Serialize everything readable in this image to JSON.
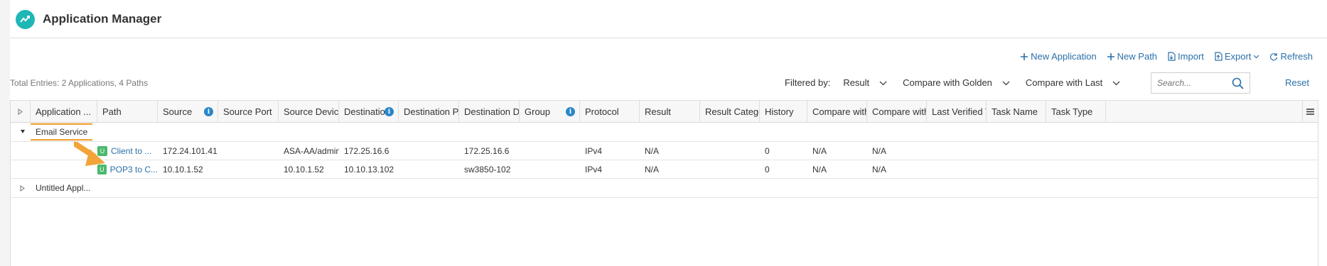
{
  "app": {
    "title": "Application Manager"
  },
  "toolbar": {
    "new_application": "New Application",
    "new_path": "New Path",
    "import": "Import",
    "export": "Export",
    "refresh": "Refresh"
  },
  "summary": {
    "total_entries": "Total Entries: 2 Applications, 4 Paths"
  },
  "filters": {
    "label": "Filtered by:",
    "result": "Result",
    "compare_golden": "Compare with Golden",
    "compare_last": "Compare with Last",
    "search_placeholder": "Search...",
    "reset": "Reset"
  },
  "columns": [
    "Application ...",
    "Path",
    "Source",
    "Source Port",
    "Source Device...",
    "Destination",
    "Destination P...",
    "Destination D...",
    "Group",
    "Protocol",
    "Result",
    "Result Catego...",
    "History",
    "Compare with...",
    "Compare with...",
    "Last Verified T...",
    "Task Name",
    "Task Type"
  ],
  "groups": [
    {
      "name": "Email Service",
      "rows": [
        {
          "path": "Client to ...",
          "source": "172.24.101.41",
          "source_port": "",
          "source_device": "ASA-AA/admin...",
          "destination": "172.25.16.6",
          "destination_port": "",
          "destination_device": "172.25.16.6",
          "group": "",
          "protocol": "IPv4",
          "result": "N/A",
          "result_category": "",
          "history": "0",
          "compare_golden": "N/A",
          "compare_last": "N/A"
        },
        {
          "path": "POP3 to C...",
          "source": "10.10.1.52",
          "source_port": "",
          "source_device": "10.10.1.52",
          "destination": "10.10.13.102",
          "destination_port": "",
          "destination_device": "sw3850-102",
          "group": "",
          "protocol": "IPv4",
          "result": "N/A",
          "result_category": "",
          "history": "0",
          "compare_golden": "N/A",
          "compare_last": "N/A"
        }
      ]
    },
    {
      "name": "Untitled Appl..."
    }
  ],
  "colors": {
    "accent": "#2a6fa8",
    "logo": "#1fb6b6",
    "highlight": "#f2a33a",
    "path_badge": "#4bb86d",
    "info_icon": "#2a86c8"
  }
}
